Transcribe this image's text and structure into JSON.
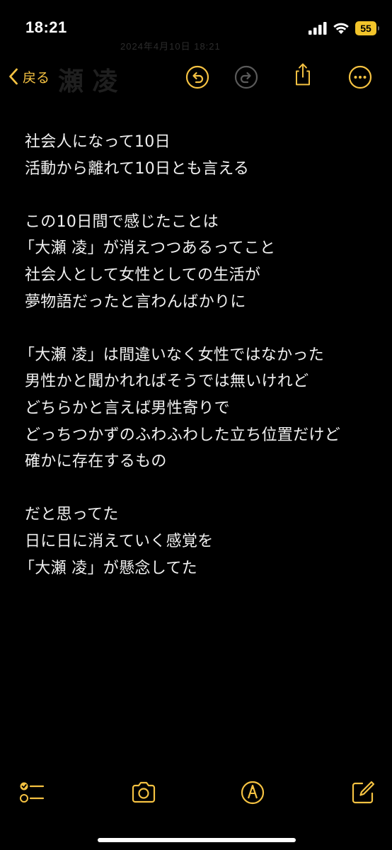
{
  "status_bar": {
    "time": "18:21",
    "battery": "55",
    "icons": [
      "cellular-signal-icon",
      "wifi-icon",
      "battery-icon"
    ]
  },
  "ghost_header": {
    "date": "2024年4月10日 18:21",
    "title": "瀬 凌"
  },
  "nav": {
    "back_label": "戻る",
    "icons": [
      "undo-icon",
      "redo-icon",
      "share-icon",
      "more-icon"
    ]
  },
  "note": {
    "lines": [
      "社会人になって10日",
      "活動から離れて10日とも言える",
      "",
      "この10日間で感じたことは",
      "「大瀬 凌」が消えつつあるってこと",
      "社会人として女性としての生活が",
      "夢物語だったと言わんばかりに",
      "",
      "「大瀬 凌」は間違いなく女性ではなかった",
      "男性かと聞かれればそうでは無いけれど",
      "どちらかと言えば男性寄りで",
      "どっちつかずのふわふわした立ち位置だけど",
      "確かに存在するもの",
      "",
      "だと思ってた",
      "日に日に消えていく感覚を",
      "「大瀬 凌」が懸念してた"
    ]
  },
  "toolbar": {
    "icons": [
      "checklist-icon",
      "camera-icon",
      "markup-pen-icon",
      "compose-icon"
    ]
  },
  "colors": {
    "accent": "#f5c242",
    "background": "#000000",
    "text": "#f0f0f0",
    "disabled": "#5a5a5a"
  }
}
